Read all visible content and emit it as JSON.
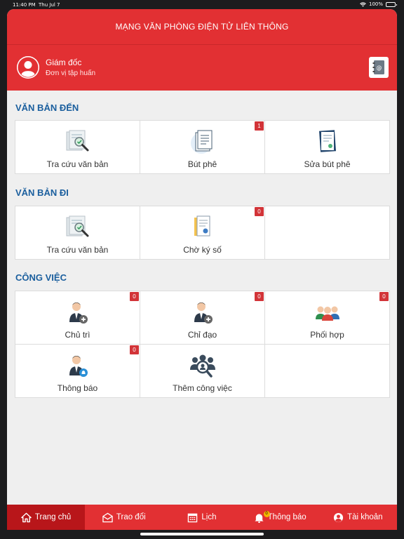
{
  "status_bar": {
    "time": "11:40 PM",
    "date": "Thu Jul 7",
    "battery": "100%"
  },
  "header": {
    "title": "MẠNG VĂN PHÒNG ĐIỆN TỬ LIÊN THÔNG"
  },
  "user": {
    "role": "Giám đốc",
    "unit": "Đơn vị tập huấn"
  },
  "sections": {
    "incoming": {
      "title": "VĂN BẢN ĐẾN",
      "items": [
        {
          "label": "Tra cứu văn bản",
          "badge": ""
        },
        {
          "label": "Bút phê",
          "badge": "1"
        },
        {
          "label": "Sửa bút phê",
          "badge": ""
        }
      ]
    },
    "outgoing": {
      "title": "VĂN BẢN ĐI",
      "items": [
        {
          "label": "Tra cứu văn bản",
          "badge": ""
        },
        {
          "label": "Chờ ký số",
          "badge": "0"
        }
      ]
    },
    "work": {
      "title": "CÔNG VIỆC",
      "items": [
        {
          "label": "Chủ trì",
          "badge": "0"
        },
        {
          "label": "Chỉ đạo",
          "badge": "0"
        },
        {
          "label": "Phối hợp",
          "badge": "0"
        },
        {
          "label": "Thông báo",
          "badge": "0"
        },
        {
          "label": "Thêm công việc",
          "badge": ""
        }
      ]
    }
  },
  "tabbar": {
    "items": [
      {
        "label": "Trang chủ",
        "icon": "home-icon"
      },
      {
        "label": "Trao đổi",
        "icon": "mail-icon"
      },
      {
        "label": "Lịch",
        "icon": "calendar-icon"
      },
      {
        "label": "Thông báo",
        "icon": "bell-icon",
        "count": "0"
      },
      {
        "label": "Tài khoản",
        "icon": "account-icon"
      }
    ],
    "active_index": 0
  },
  "colors": {
    "brand_red": "#e23033",
    "active_tab": "#b8161a",
    "section_blue": "#1b5f9e",
    "badge_red": "#d23438"
  }
}
